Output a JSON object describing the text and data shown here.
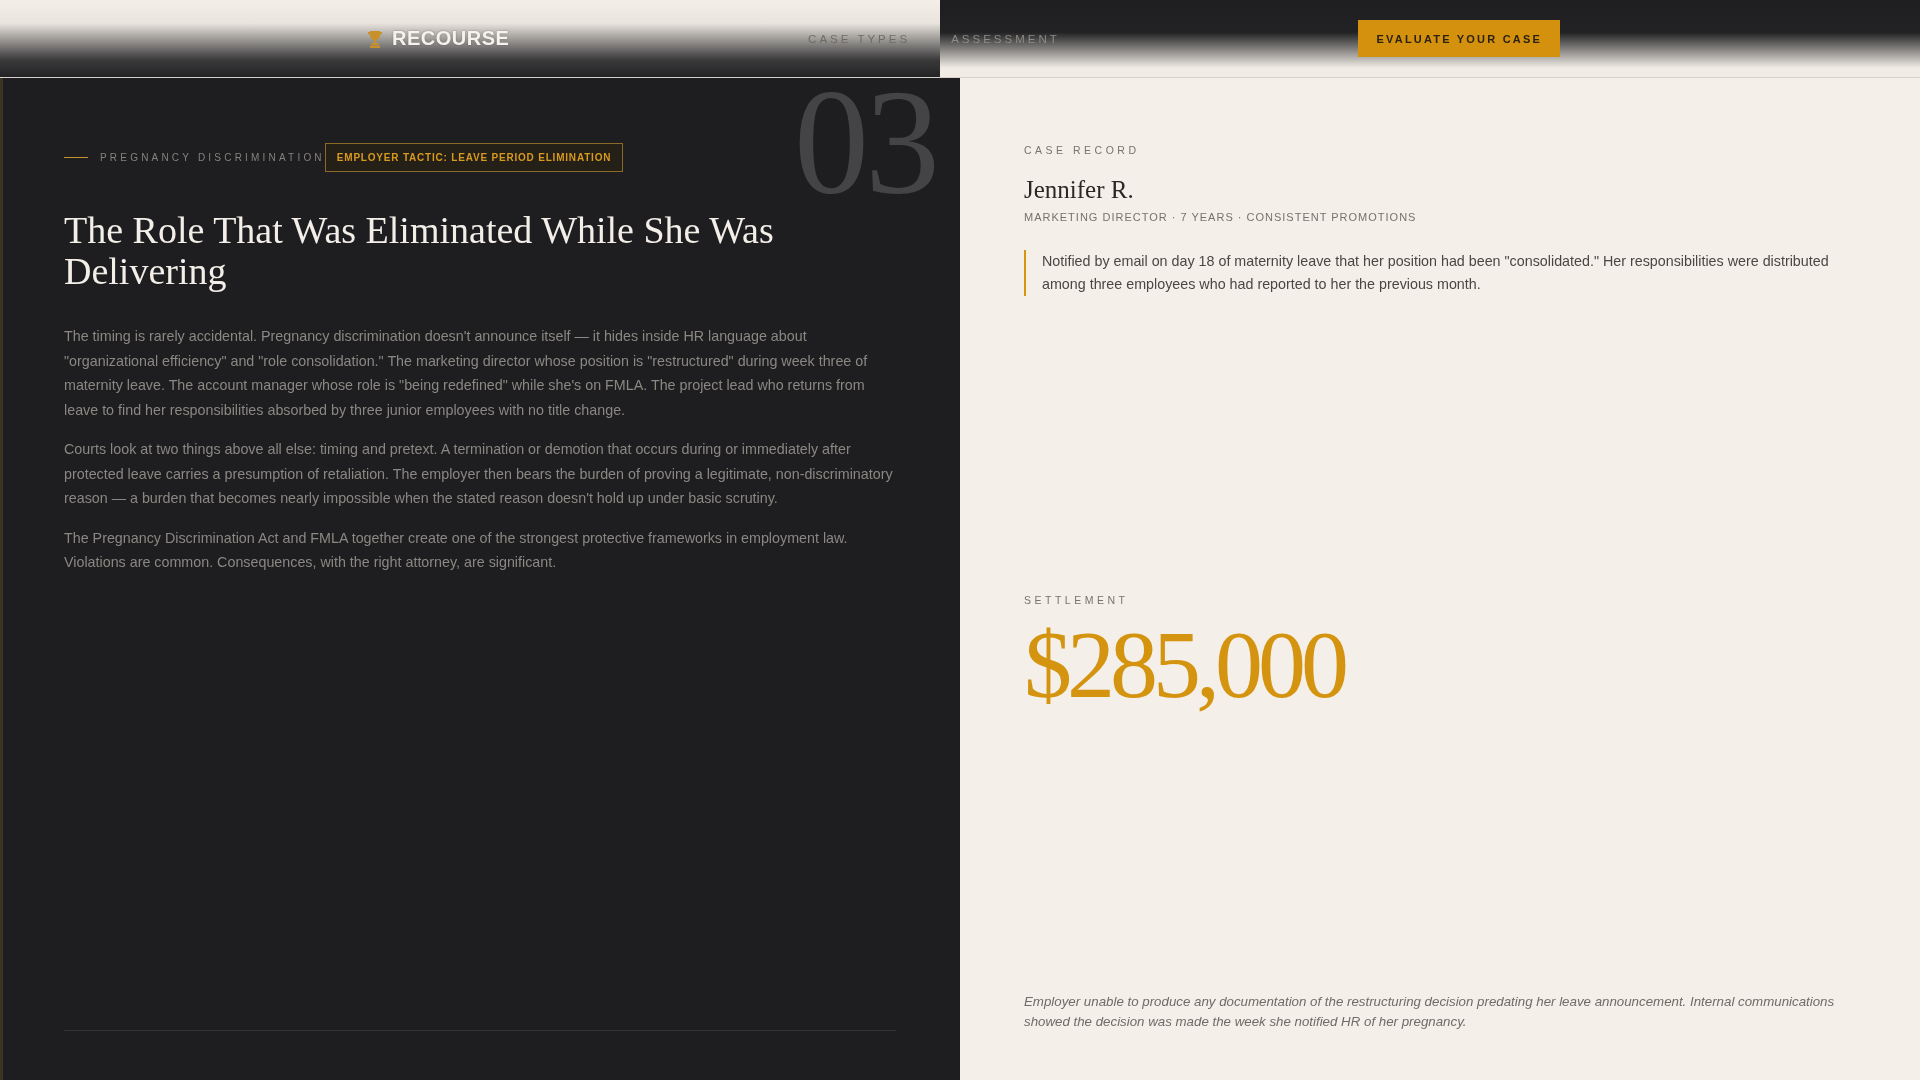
{
  "header": {
    "logo": "RECOURSE",
    "nav": [
      "CASE TYPES",
      "ASSESSMENT"
    ],
    "cta": "EVALUATE YOUR CASE"
  },
  "article": {
    "number": "03",
    "category": "PREGNANCY DISCRIMINATION",
    "tactic_badge": "EMPLOYER TACTIC: LEAVE PERIOD ELIMINATION",
    "title": "The Role That Was Eliminated While She Was Delivering",
    "paragraphs": [
      "The timing is rarely accidental. Pregnancy discrimination doesn't announce itself — it hides inside HR language about \"organizational efficiency\" and \"role consolidation.\" The marketing director whose position is \"restructured\" during week three of maternity leave. The account manager whose role is \"being redefined\" while she's on FMLA. The project lead who returns from leave to find her responsibilities absorbed by three junior employees with no title change.",
      "Courts look at two things above all else: timing and pretext. A termination or demotion that occurs during or immediately after protected leave carries a presumption of retaliation. The employer then bears the burden of proving a legitimate, non-discriminatory reason — a burden that becomes nearly impossible when the stated reason doesn't hold up under basic scrutiny.",
      "The Pregnancy Discrimination Act and FMLA together create one of the strongest protective frameworks in employment law. Violations are common. Consequences, with the right attorney, are significant."
    ]
  },
  "case_record": {
    "label": "CASE RECORD",
    "name": "Jennifer R.",
    "details": "MARKETING DIRECTOR · 7 YEARS · CONSISTENT PROMOTIONS",
    "quote": "Notified by email on day 18 of maternity leave that her position had been \"consolidated.\" Her responsibilities were distributed among three employees who had reported to her the previous month.",
    "settlement_label": "SETTLEMENT",
    "settlement_amount": "$285,000",
    "note": "Employer unable to produce any documentation of the restructuring decision predating her leave announcement. Internal communications showed the decision was made the week she notified HR of her pregnancy."
  }
}
